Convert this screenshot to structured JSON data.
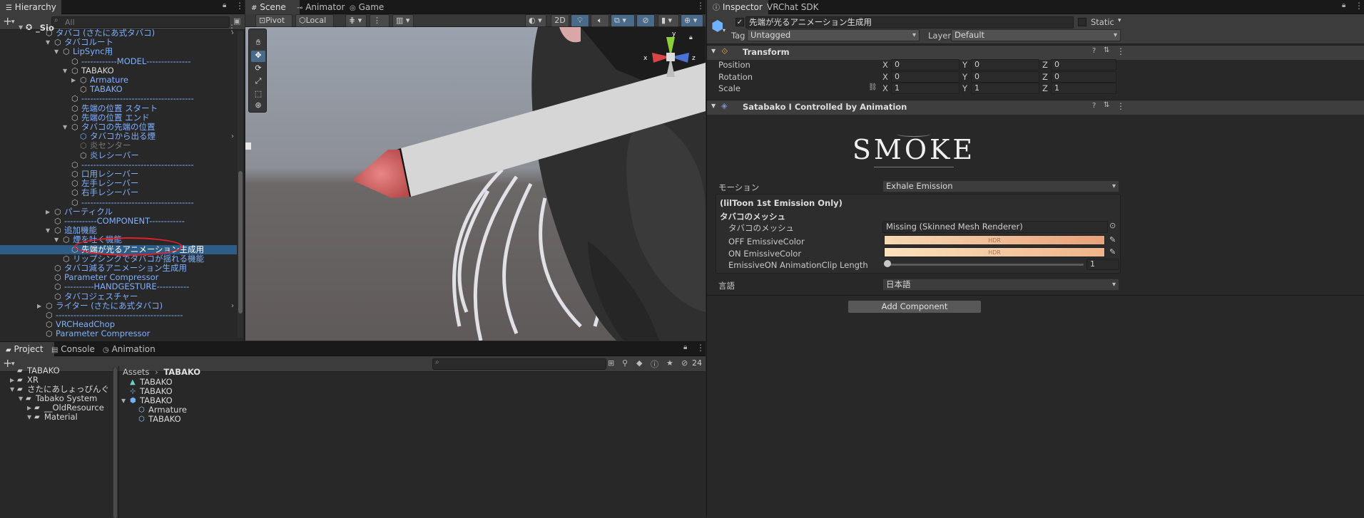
{
  "hierarchy": {
    "tab": "Hierarchy",
    "search_placeholder": "All",
    "root": "_Sio",
    "items": [
      {
        "label": "タバコ (さたにあ式タバコ)",
        "indent": 4,
        "color": "blue",
        "arrow": ""
      },
      {
        "label": "タバコルート",
        "indent": 5,
        "color": "blue",
        "arrow": "▼"
      },
      {
        "label": "LipSync用",
        "indent": 6,
        "color": "blue",
        "arrow": "▼"
      },
      {
        "label": "------------MODEL---------------",
        "indent": 7,
        "color": "blue",
        "arrow": ""
      },
      {
        "label": "TABAKO",
        "indent": 7,
        "color": "white",
        "arrow": "▼"
      },
      {
        "label": "Armature",
        "indent": 8,
        "color": "blue",
        "arrow": "▶"
      },
      {
        "label": "TABAKO",
        "indent": 8,
        "color": "blue",
        "arrow": ""
      },
      {
        "label": "--------------------------------------",
        "indent": 7,
        "color": "blue",
        "arrow": ""
      },
      {
        "label": "先端の位置 スタート",
        "indent": 7,
        "color": "blue",
        "arrow": ""
      },
      {
        "label": "先端の位置 エンド",
        "indent": 7,
        "color": "blue",
        "arrow": ""
      },
      {
        "label": "タバコの先端の位置",
        "indent": 7,
        "color": "blue",
        "arrow": "▼"
      },
      {
        "label": "タバコから出る煙",
        "indent": 8,
        "color": "blue",
        "arrow": ""
      },
      {
        "label": "炎センター",
        "indent": 8,
        "color": "gray",
        "arrow": ""
      },
      {
        "label": "炎レシーバー",
        "indent": 8,
        "color": "blue",
        "arrow": ""
      },
      {
        "label": "--------------------------------------",
        "indent": 7,
        "color": "blue",
        "arrow": ""
      },
      {
        "label": "口用レシーバー",
        "indent": 7,
        "color": "blue",
        "arrow": ""
      },
      {
        "label": "左手レシーバー",
        "indent": 7,
        "color": "blue",
        "arrow": ""
      },
      {
        "label": "右手レシーバー",
        "indent": 7,
        "color": "blue",
        "arrow": ""
      },
      {
        "label": "--------------------------------------",
        "indent": 7,
        "color": "blue",
        "arrow": ""
      },
      {
        "label": "パーティクル",
        "indent": 5,
        "color": "blue",
        "arrow": "▶"
      },
      {
        "label": "-----------COMPONENT------------",
        "indent": 5,
        "color": "blue",
        "arrow": ""
      },
      {
        "label": "追加機能",
        "indent": 5,
        "color": "blue",
        "arrow": "▼"
      },
      {
        "label": "煙を吐く機能",
        "indent": 6,
        "color": "blue",
        "arrow": "▼"
      },
      {
        "label": "先端が光るアニメーション生成用",
        "indent": 7,
        "color": "white",
        "arrow": "",
        "selected": true
      },
      {
        "label": "リップシンクでタバコが揺れる機能",
        "indent": 6,
        "color": "blue",
        "arrow": ""
      },
      {
        "label": "タバコ減るアニメーション生成用",
        "indent": 5,
        "color": "blue",
        "arrow": ""
      },
      {
        "label": "Parameter Compressor",
        "indent": 5,
        "color": "blue",
        "arrow": ""
      },
      {
        "label": "----------HANDGESTURE-----------",
        "indent": 5,
        "color": "blue",
        "arrow": ""
      },
      {
        "label": "タバコジェスチャー",
        "indent": 5,
        "color": "blue",
        "arrow": ""
      },
      {
        "label": "ライター (さたにあ式タバコ)",
        "indent": 4,
        "color": "blue",
        "arrow": "▶"
      },
      {
        "label": "-------------------------------------------",
        "indent": 4,
        "color": "blue",
        "arrow": ""
      },
      {
        "label": "VRCHeadChop",
        "indent": 4,
        "color": "blue",
        "arrow": ""
      },
      {
        "label": "Parameter Compressor",
        "indent": 4,
        "color": "blue",
        "arrow": ""
      }
    ]
  },
  "scene": {
    "tabs": [
      "Scene",
      "Animator",
      "Game"
    ],
    "pivot": "Pivot",
    "local": "Local",
    "mode_2d": "2D",
    "gizmo_axes": {
      "y": "y",
      "x": "x",
      "z": "z"
    }
  },
  "inspector": {
    "tabs": [
      "Inspector",
      "VRChat SDK"
    ],
    "object_name": "先端が光るアニメーション生成用",
    "static_label": "Static",
    "tag_label": "Tag",
    "tag_value": "Untagged",
    "layer_label": "Layer",
    "layer_value": "Default",
    "transform_title": "Transform",
    "position_label": "Position",
    "rotation_label": "Rotation",
    "scale_label": "Scale",
    "axis": {
      "x": "X",
      "y": "Y",
      "z": "Z"
    },
    "position": [
      "0",
      "0",
      "0"
    ],
    "rotation": [
      "0",
      "0",
      "0"
    ],
    "scale": [
      "1",
      "1",
      "1"
    ],
    "component_title": "Satabako I Controlled by Animation",
    "logo_text": "SMOKE",
    "motion_label": "モーション",
    "motion_value": "Exhale Emission",
    "note": "(lilToon 1st Emission Only)",
    "mesh_section": "タバコのメッシュ",
    "mesh_label": "タバコのメッシュ",
    "mesh_value": "Missing (Skinned Mesh Renderer)",
    "off_color_label": "OFF EmissiveColor",
    "on_color_label": "ON EmissiveColor",
    "hdr": "HDR",
    "clip_length_label": "EmissiveON AnimationClip Length",
    "clip_length_value": "1",
    "language_label": "言語",
    "language_value": "日本語",
    "add_component": "Add Component"
  },
  "project": {
    "tabs": [
      "Project",
      "Console",
      "Animation"
    ],
    "hidden_count": "24",
    "tree": [
      {
        "label": "TABAKO",
        "indent": 1,
        "arrow": ""
      },
      {
        "label": "XR",
        "indent": 1,
        "arrow": "▶"
      },
      {
        "label": "さたにあしょっぴんぐ",
        "indent": 1,
        "arrow": "▼"
      },
      {
        "label": "Tabako System",
        "indent": 2,
        "arrow": "▼"
      },
      {
        "label": "__OldResource",
        "indent": 3,
        "arrow": "▶"
      },
      {
        "label": "Material",
        "indent": 3,
        "arrow": "▼"
      }
    ],
    "breadcrumb": [
      "Assets",
      "TABAKO"
    ],
    "assets": [
      {
        "label": "TABAKO",
        "indent": 0,
        "arrow": ""
      },
      {
        "label": "TABAKO",
        "indent": 0,
        "arrow": ""
      },
      {
        "label": "TABAKO",
        "indent": 0,
        "arrow": "▼"
      },
      {
        "label": "Armature",
        "indent": 1,
        "arrow": ""
      },
      {
        "label": "TABAKO",
        "indent": 1,
        "arrow": ""
      }
    ]
  },
  "colors": {
    "selection": "#2c5d87",
    "prefab_text": "#7fb0ff",
    "off_emissive_left": "#f6d9b4",
    "off_emissive_right": "#e9a27a",
    "on_emissive_left": "#f8e2bd",
    "on_emissive_right": "#f0b48a",
    "highlight_circle": "#e0202a"
  }
}
